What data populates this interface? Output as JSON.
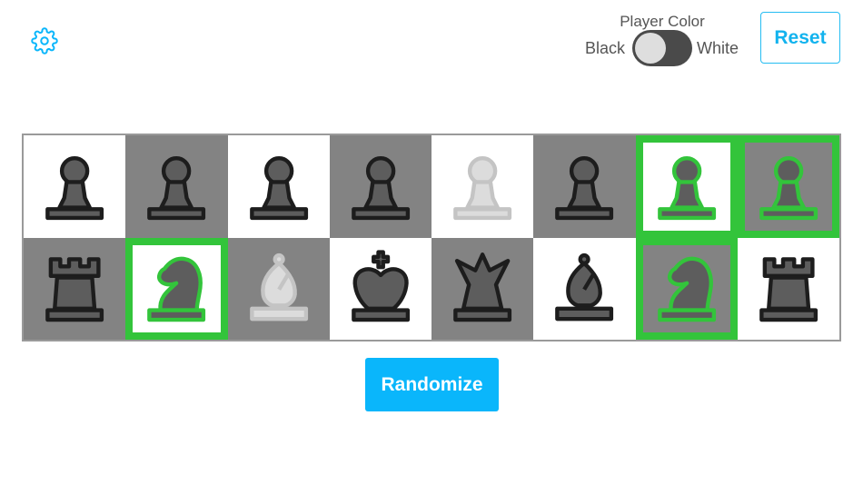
{
  "settings": {
    "icon": "gear-icon"
  },
  "player_color": {
    "title": "Player Color",
    "left_label": "Black",
    "right_label": "White",
    "selected": "Black"
  },
  "reset_label": "Reset",
  "randomize_label": "Randomize",
  "colors": {
    "accent": "#0ab6fb",
    "highlight": "#33c43b",
    "dark_square": "#838383",
    "light_square": "#ffffff",
    "toggle_track": "#4a4a4a"
  },
  "board": {
    "rows": [
      [
        {
          "piece": "pawn",
          "shade": "black",
          "highlighted": false
        },
        {
          "piece": "pawn",
          "shade": "black",
          "highlighted": false
        },
        {
          "piece": "pawn",
          "shade": "black",
          "highlighted": false
        },
        {
          "piece": "pawn",
          "shade": "black",
          "highlighted": false
        },
        {
          "piece": "pawn",
          "shade": "white",
          "highlighted": false
        },
        {
          "piece": "pawn",
          "shade": "black",
          "highlighted": false
        },
        {
          "piece": "pawn",
          "shade": "black",
          "highlighted": true
        },
        {
          "piece": "pawn",
          "shade": "black",
          "highlighted": true
        }
      ],
      [
        {
          "piece": "rook",
          "shade": "black",
          "highlighted": false
        },
        {
          "piece": "knight",
          "shade": "black",
          "highlighted": true
        },
        {
          "piece": "bishop",
          "shade": "white",
          "highlighted": false
        },
        {
          "piece": "king",
          "shade": "black",
          "highlighted": false
        },
        {
          "piece": "queen",
          "shade": "black",
          "highlighted": false
        },
        {
          "piece": "bishop",
          "shade": "black",
          "highlighted": false
        },
        {
          "piece": "knight",
          "shade": "black",
          "highlighted": true
        },
        {
          "piece": "rook",
          "shade": "black",
          "highlighted": false
        }
      ]
    ]
  }
}
